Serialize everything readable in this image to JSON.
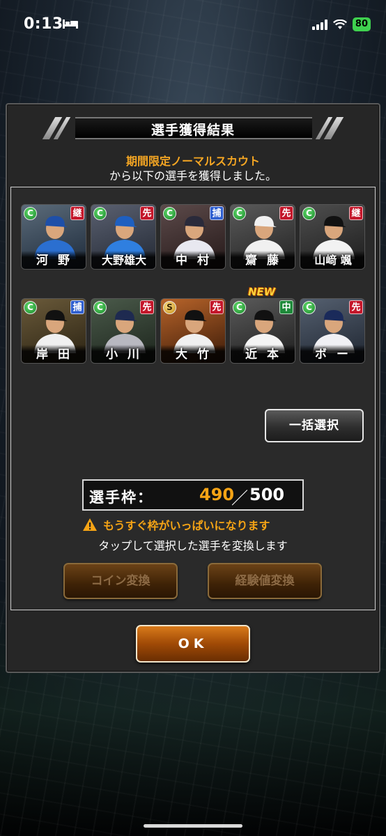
{
  "status_bar": {
    "time": "0:13",
    "battery": "80"
  },
  "dialog": {
    "title": "選手獲得結果",
    "scout_name": "期間限定ノーマルスカウト",
    "message": "から以下の選手を獲得しました。"
  },
  "players": [
    {
      "name": "河 野",
      "rank": "C",
      "position": "継",
      "pos_color": "red"
    },
    {
      "name": "大野雄大",
      "rank": "C",
      "position": "先",
      "pos_color": "red"
    },
    {
      "name": "中 村",
      "rank": "C",
      "position": "捕",
      "pos_color": "blue"
    },
    {
      "name": "齋 藤",
      "rank": "C",
      "position": "先",
      "pos_color": "red"
    },
    {
      "name": "山﨑 颯",
      "rank": "C",
      "position": "継",
      "pos_color": "red"
    },
    {
      "name": "岸 田",
      "rank": "C",
      "position": "捕",
      "pos_color": "blue"
    },
    {
      "name": "小 川",
      "rank": "C",
      "position": "先",
      "pos_color": "red"
    },
    {
      "name": "大 竹",
      "rank": "S",
      "position": "先",
      "pos_color": "red"
    },
    {
      "name": "近 本",
      "rank": "C",
      "position": "中",
      "pos_color": "green",
      "new": "NEW"
    },
    {
      "name": "ボ ー",
      "rank": "C",
      "position": "先",
      "pos_color": "red"
    }
  ],
  "bulk_select_label": "一括選択",
  "slots": {
    "label": "選手枠：",
    "current": "490",
    "separator": "／",
    "max": "500"
  },
  "warning": "もうすぐ枠がいっぱいになります",
  "instruction": "タップして選択した選手を変換します",
  "buttons": {
    "coin_convert": "コイン変換",
    "exp_convert": "経験値変換",
    "ok": "OK"
  },
  "colors": {
    "accent": "#f6a415",
    "rank_c": "#1b8a2b",
    "pos_red": "#c4162a",
    "pos_blue": "#2f5fd0",
    "pos_green": "#1f8a3a"
  }
}
